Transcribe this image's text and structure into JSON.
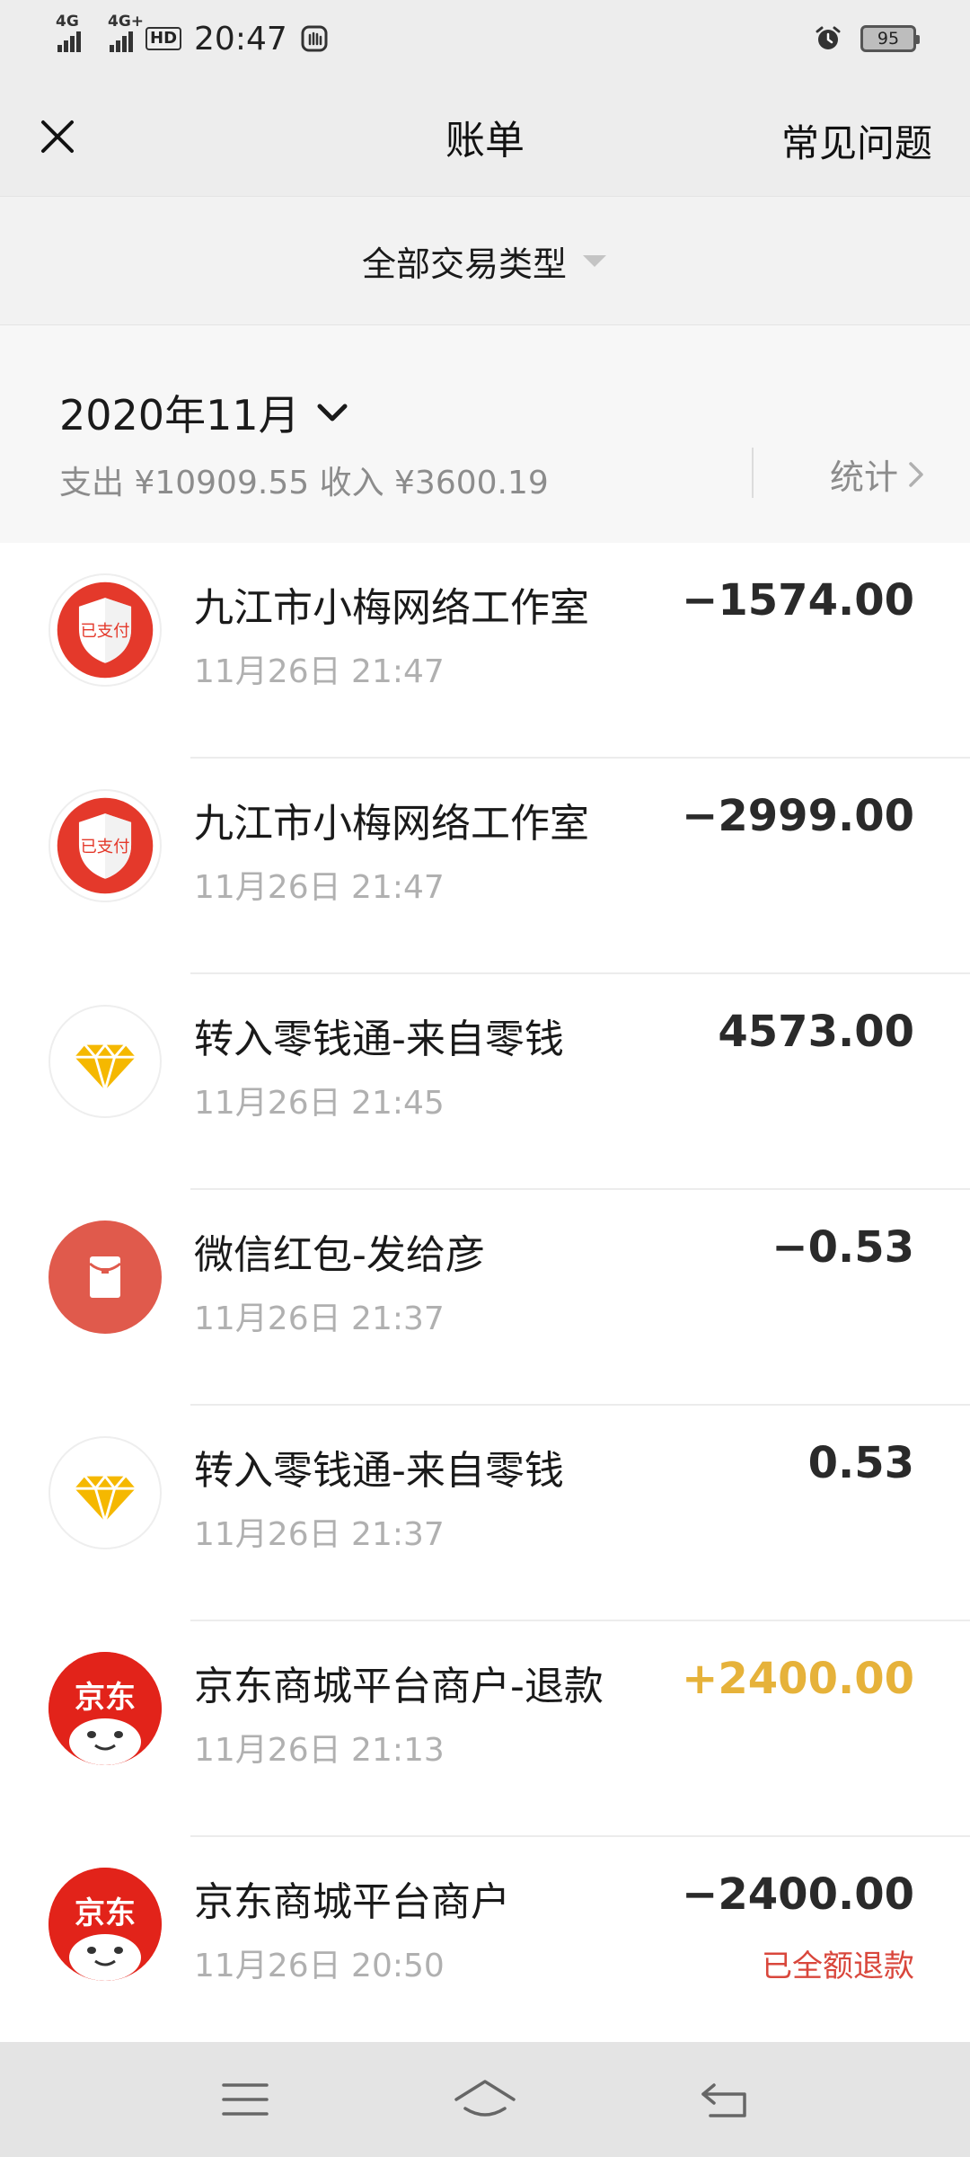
{
  "status_bar": {
    "signal1": "4G",
    "signal2": "4G+",
    "hd": "HD",
    "time": "20:47",
    "battery": "95"
  },
  "header": {
    "title": "账单",
    "faq": "常见问题"
  },
  "filter": {
    "label": "全部交易类型"
  },
  "month": {
    "label": "2020年11月",
    "summary": "支出 ¥10909.55 收入 ¥3600.19",
    "stats": "统计"
  },
  "transactions": [
    {
      "title": "九江市小梅网络工作室",
      "time": "11月26日 21:47",
      "amount": "−1574.00",
      "icon": "paid-shield-icon",
      "note": ""
    },
    {
      "title": "九江市小梅网络工作室",
      "time": "11月26日 21:47",
      "amount": "−2999.00",
      "icon": "paid-shield-icon",
      "note": ""
    },
    {
      "title": "转入零钱通-来自零钱",
      "time": "11月26日 21:45",
      "amount": "4573.00",
      "icon": "diamond-icon",
      "note": ""
    },
    {
      "title": "微信红包-发给彦",
      "time": "11月26日 21:37",
      "amount": "−0.53",
      "icon": "red-packet-icon",
      "note": ""
    },
    {
      "title": "转入零钱通-来自零钱",
      "time": "11月26日 21:37",
      "amount": "0.53",
      "icon": "diamond-icon",
      "note": ""
    },
    {
      "title": "京东商城平台商户-退款",
      "time": "11月26日 21:13",
      "amount": "+2400.00",
      "icon": "jd-logo-icon",
      "note": ""
    },
    {
      "title": "京东商城平台商户",
      "time": "11月26日 20:50",
      "amount": "−2400.00",
      "icon": "jd-logo-icon",
      "note": "已全额退款"
    }
  ],
  "jd_logo_text": "京东",
  "paid_stamp_text": "已支付",
  "colors": {
    "header_bg": "#ededed",
    "income_amount": "#e6b23a",
    "refund_note": "#d9473c",
    "jd_red": "#e2231a",
    "red_packet": "#e05a4c",
    "diamond": "#f5b800"
  }
}
